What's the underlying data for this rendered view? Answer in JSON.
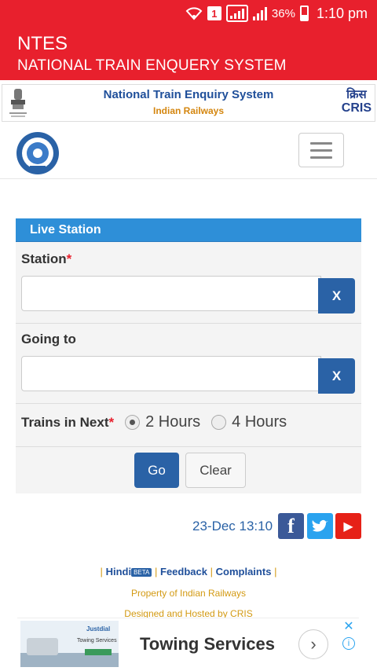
{
  "status_bar": {
    "sim_label": "1",
    "battery": "36%",
    "time": "1:10 pm"
  },
  "app_header": {
    "title": "NTES",
    "subtitle": "NATIONAL TRAIN ENQUERY SYSTEM"
  },
  "banner": {
    "title": "National Train Enquiry System",
    "subtitle": "Indian Railways",
    "cris_hindi": "क्रिस",
    "cris_en": "CRIS"
  },
  "form": {
    "heading": "Live Station",
    "station_label": "Station",
    "station_required": "*",
    "station_value": "",
    "station_clear": "X",
    "going_to_label": "Going to",
    "going_to_value": "",
    "going_to_clear": "X",
    "trains_in_next_label": "Trains in Next",
    "trains_in_next_required": "*",
    "options": [
      "2 Hours",
      "4 Hours"
    ],
    "selected_option": "2 Hours",
    "go_button": "Go",
    "clear_button": "Clear"
  },
  "date_time": "23-Dec 13:10",
  "social": {
    "facebook": "f",
    "twitter": "t",
    "youtube": "▶"
  },
  "footer": {
    "links": [
      "Hindi",
      "Feedback",
      "Complaints"
    ],
    "beta": "BETA",
    "sep": "|",
    "property": "Property of Indian Railways",
    "designed": "Designed and Hosted by CRIS"
  },
  "ad": {
    "brand": "Justdial",
    "thumb_text": "Towing Services",
    "title": "Towing Services",
    "arrow": "›",
    "close": "✕",
    "info": "i"
  },
  "colors": {
    "header_red": "#e8202d",
    "panel_blue": "#2e8fd8",
    "button_blue": "#2a62a6",
    "footer_gold": "#d39a13"
  }
}
